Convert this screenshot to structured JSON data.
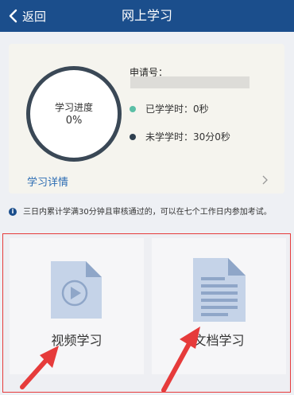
{
  "nav": {
    "back_label": "返回",
    "title": "网上学习"
  },
  "progress": {
    "label": "学习进度",
    "value": "0%"
  },
  "application": {
    "label": "申请号："
  },
  "stats": {
    "learned": {
      "text": "已学学时：0秒",
      "color": "#5bbfa6"
    },
    "unlearned": {
      "text": "未学学时：30分0秒",
      "color": "#2e3f4f"
    }
  },
  "detail": {
    "label": "学习详情"
  },
  "notice": {
    "text": "三日内累计学满30分钟且审核通过的，可以在七个工作日内参加考试。"
  },
  "tiles": [
    {
      "label": "视频学习",
      "icon": "video-file-icon"
    },
    {
      "label": "文档学习",
      "icon": "document-file-icon"
    }
  ],
  "colors": {
    "nav_bg": "#1b4e8c",
    "link": "#2c6cb3",
    "highlight": "#e63b3b",
    "icon_fill": "#c5d3e8"
  }
}
